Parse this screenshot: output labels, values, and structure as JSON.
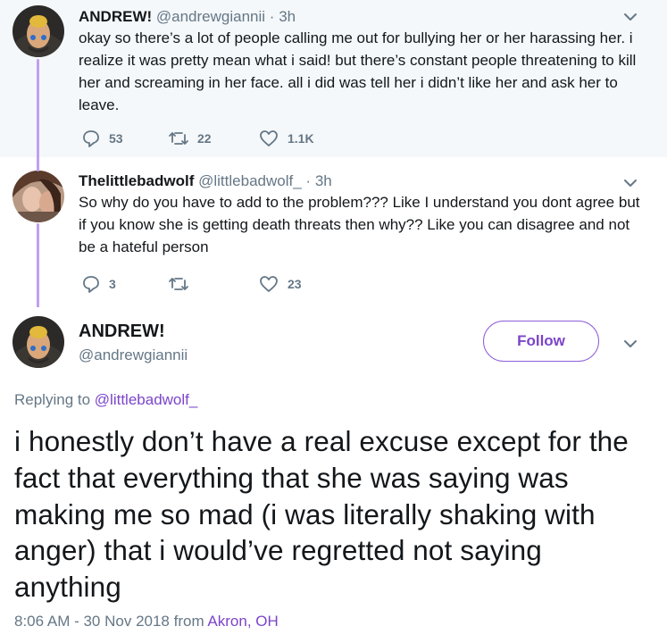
{
  "thread": [
    {
      "name": "ANDREW!",
      "handle": "@andrewgiannii",
      "separator": "·",
      "time": "3h",
      "text": "okay so there’s a lot of people calling me out for bullying her or her harassing her. i realize it was pretty mean what i said! but there’s constant people threatening to kill her and screaming in her face. all i did was tell her i didn’t like her and ask her to leave.",
      "replies": "53",
      "retweets": "22",
      "likes": "1.1K"
    },
    {
      "name": "Thelittlebadwolf",
      "handle": "@littlebadwolf_",
      "separator": "·",
      "time": "3h",
      "text": "So why do you have to add to the problem??? Like I understand you dont agree but if you know she is getting death threats then why?? Like you can disagree and not be a hateful person",
      "replies": "3",
      "retweets": "",
      "likes": "23"
    }
  ],
  "main": {
    "name": "ANDREW!",
    "handle": "@andrewgiannii",
    "follow_label": "Follow",
    "replying_prefix": "Replying to",
    "replying_to": "@littlebadwolf_",
    "text": "i honestly don’t have a real excuse except for the fact that everything that she was saying was making me so mad (i was literally shaking with anger) that i would’ve regretted not saying anything",
    "timestamp": "8:06 AM - 30 Nov 2018",
    "from_label": "from",
    "location": "Akron, OH"
  },
  "colors": {
    "accent": "#7b45c9",
    "thread_line": "#c29ff0",
    "muted": "#657786",
    "reply_bg": "#f5f8fa"
  },
  "icons": [
    "reply-icon",
    "retweet-icon",
    "like-icon",
    "chevron-down-icon"
  ]
}
